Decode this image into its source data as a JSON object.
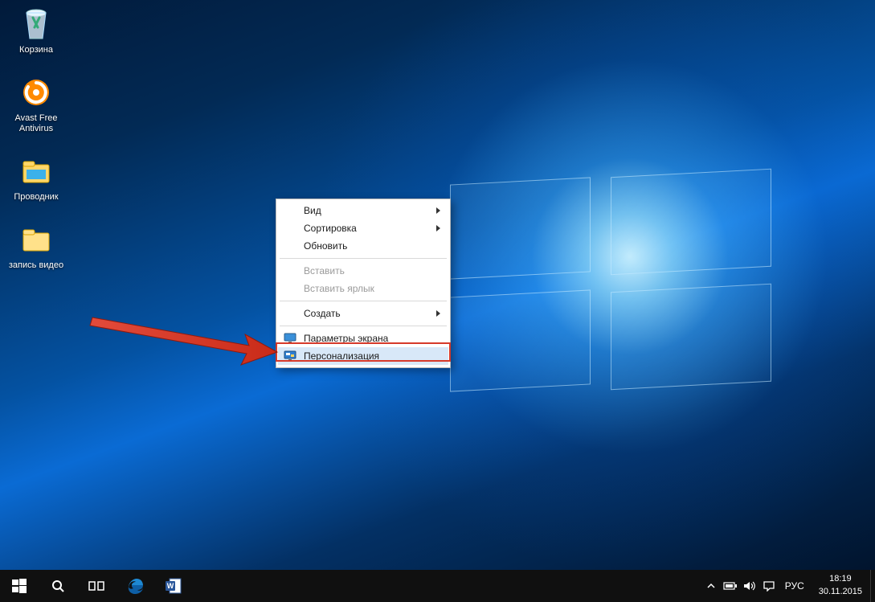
{
  "desktop_icons": [
    {
      "id": "recycle-bin",
      "label": "Корзина"
    },
    {
      "id": "avast",
      "label": "Avast Free Antivirus"
    },
    {
      "id": "explorer",
      "label": "Проводник"
    },
    {
      "id": "video-folder",
      "label": "запись видео"
    }
  ],
  "context_menu": {
    "items": [
      {
        "label": "Вид",
        "submenu": true,
        "disabled": false
      },
      {
        "label": "Сортировка",
        "submenu": true,
        "disabled": false
      },
      {
        "label": "Обновить",
        "submenu": false,
        "disabled": false
      }
    ],
    "paste_items": [
      {
        "label": "Вставить",
        "submenu": false,
        "disabled": true
      },
      {
        "label": "Вставить ярлык",
        "submenu": false,
        "disabled": true
      }
    ],
    "create_item": {
      "label": "Создать",
      "submenu": true,
      "disabled": false
    },
    "bottom_items": [
      {
        "label": "Параметры экрана",
        "icon": "monitor-icon",
        "submenu": false,
        "disabled": false
      },
      {
        "label": "Персонализация",
        "icon": "personalize-icon",
        "submenu": false,
        "disabled": false,
        "hovered": true,
        "highlighted": true
      }
    ]
  },
  "taskbar": {
    "apps": [
      {
        "id": "edge",
        "label": "Microsoft Edge"
      },
      {
        "id": "word",
        "label": "Word"
      }
    ],
    "tray": {
      "input_lang": "РУС",
      "time": "18:19",
      "date": "30.11.2015"
    }
  },
  "colors": {
    "highlight": "#d63a2a",
    "menu_hover": "#d8e8f8"
  }
}
